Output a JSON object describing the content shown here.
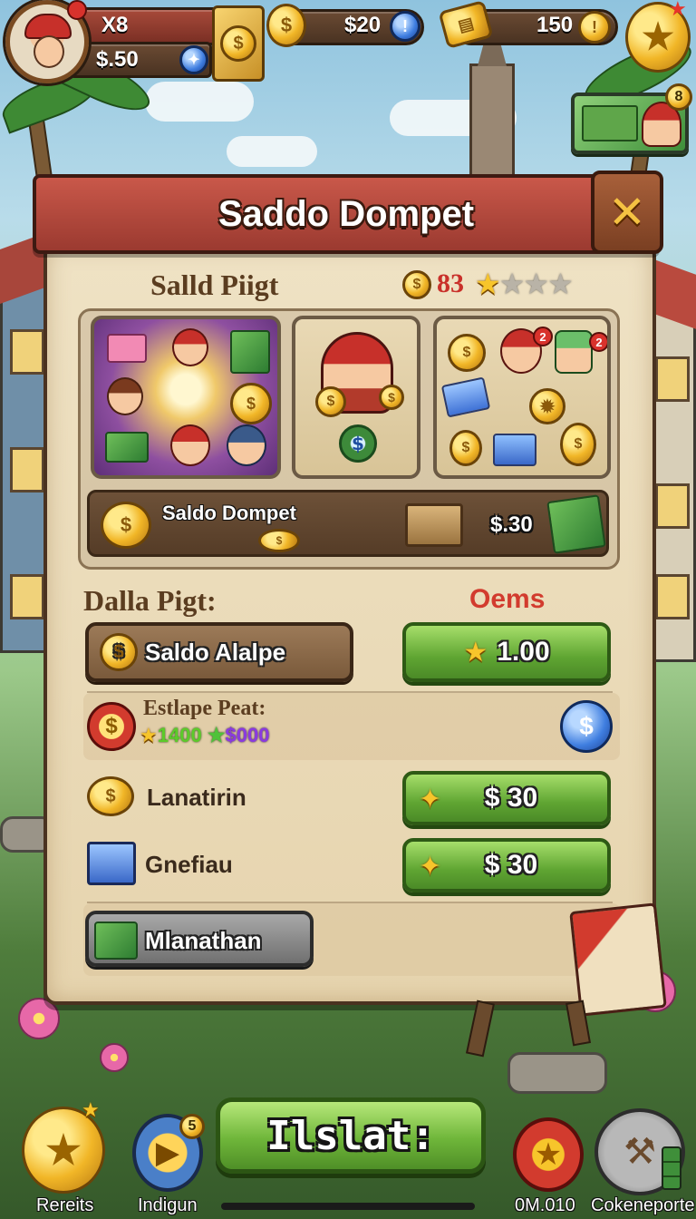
{
  "hud": {
    "lives": "X8",
    "cash": "$.50",
    "coins": "$20",
    "coins_icon_glyph": "!",
    "gold": "150",
    "gold_icon_glyph": "!",
    "wallet_badge": "8",
    "wallet_badge_icon": "wallet-cash-badge",
    "currency_badge_glyph": "$"
  },
  "dialog": {
    "title": "Saddo Dompet",
    "close_glyph": "✕",
    "section_top": "Salld Piigt",
    "score": "83",
    "stars_filled": 1,
    "stars_total": 4,
    "tile_badges": [
      "2",
      "2"
    ],
    "banner_row": {
      "label": "Saldo Dompet",
      "amount": "$.30"
    },
    "section_mid": "Dalla Pigt:",
    "section_mid_right": "Oems",
    "rows": [
      {
        "label": "Saldo Alalpe",
        "price": "1.00",
        "price_icon": "star-icon"
      },
      {
        "label": "Estlape Peat:",
        "sub_a": "1400",
        "sub_b": "$000"
      },
      {
        "label": "Lanatirin",
        "price": "$ 30",
        "price_icon": "sparkle-icon"
      },
      {
        "label": "Gnefiau",
        "price": "$ 30",
        "price_icon": "sparkle-icon"
      },
      {
        "label": "Mlanathan"
      }
    ]
  },
  "bottom": {
    "left_label": "Rereits",
    "second_label": "Indigun",
    "second_badge": "5",
    "play_label": "Ilslat:",
    "right_label": "0M.010",
    "far_right_label": "Cokeneporte"
  },
  "colors": {
    "banner_red": "#b34a3d",
    "parchment": "#ebdcb9",
    "green_button": "#6fb63a",
    "gold": "#f1b627",
    "accent_red": "#d23b2e"
  }
}
